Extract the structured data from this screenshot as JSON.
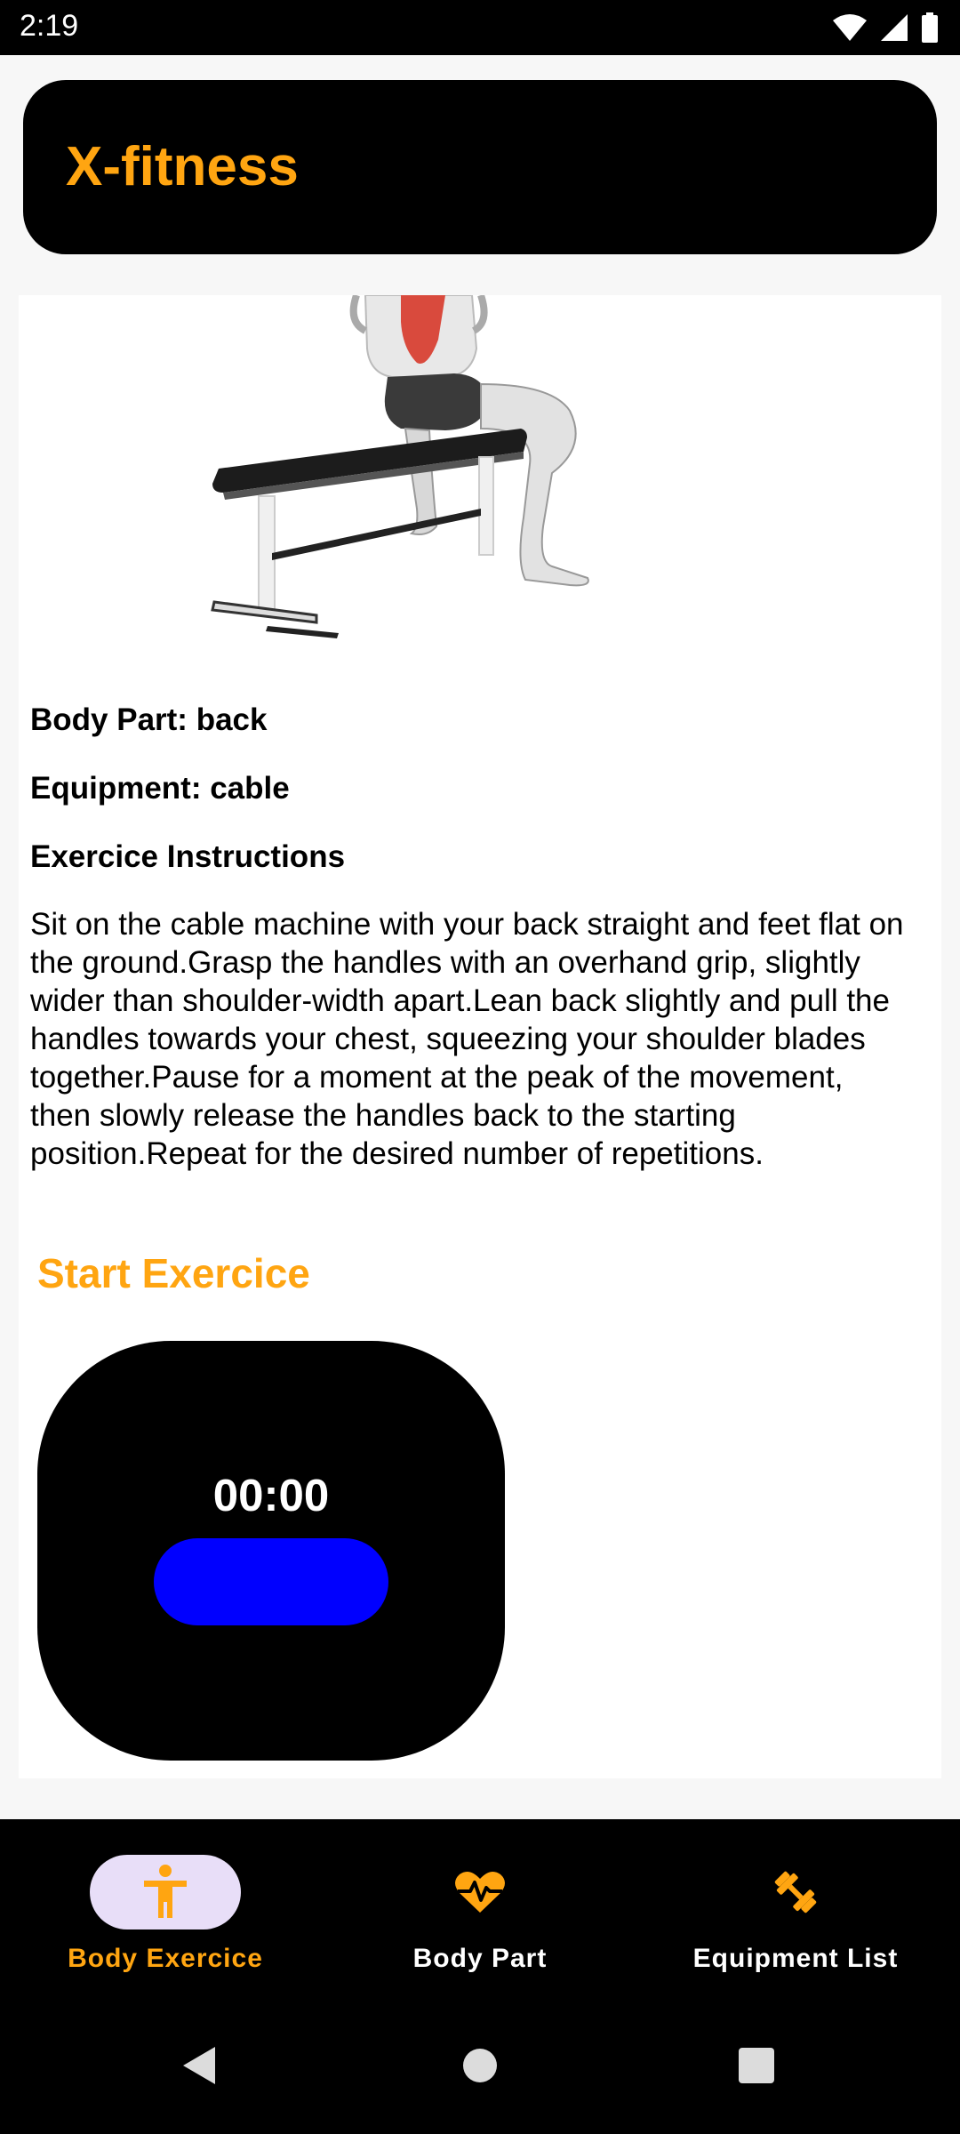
{
  "status_bar": {
    "time": "2:19",
    "icons": [
      "wifi-icon",
      "signal-icon",
      "battery-icon"
    ]
  },
  "header": {
    "title": "X-fitness"
  },
  "exercise": {
    "image_icon": "exercise-illustration",
    "body_part": "Body Part: back",
    "equipment": "Equipment: cable",
    "instructions_heading": "Exercice Instructions",
    "instructions": "Sit on the cable machine with your back straight and feet flat on the ground.Grasp the handles with an overhand grip, slightly wider than shoulder-width apart.Lean back slightly and pull the handles towards your chest, squeezing your shoulder blades together.Pause for a moment at the peak of the movement, then slowly release the handles back to the starting position.Repeat for the desired number of repetitions.",
    "start_label": "Start Exercice"
  },
  "timer": {
    "display": "00:00",
    "button_color": "#0000ff"
  },
  "bottom_nav": {
    "items": [
      {
        "label": "Body Exercice",
        "icon": "person-icon",
        "active": true
      },
      {
        "label": "Body Part",
        "icon": "heart-pulse-icon",
        "active": false
      },
      {
        "label": "Equipment List",
        "icon": "dumbbell-icon",
        "active": false
      }
    ]
  },
  "colors": {
    "accent": "#ffa511",
    "active_pill": "#e8def8",
    "header_bg": "#000000"
  },
  "system_nav": {
    "icons": [
      "back-icon",
      "home-icon",
      "recents-icon"
    ]
  }
}
